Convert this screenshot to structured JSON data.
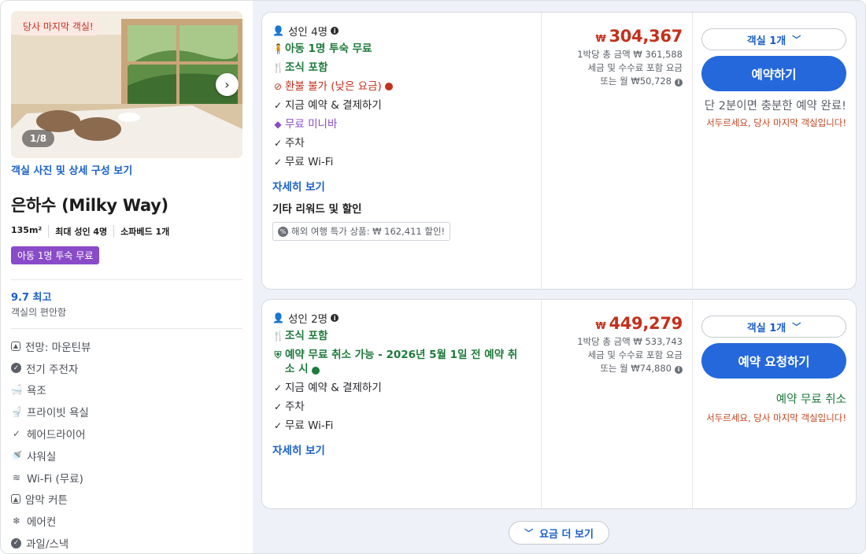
{
  "left": {
    "photo_badge": "당사 마지막 객실!",
    "photo_count": "1/8",
    "photo_link": "객실 사진 및 상세 구성 보기",
    "room_name": "은하수 (Milky Way)",
    "specs": [
      "135m²",
      "최대 성인 4명",
      "소파베드 1개"
    ],
    "promo_badge": "아동 1명 투숙 무료",
    "rating": "9.7 최고",
    "rating_sub": "객실의 편안함",
    "amenities": [
      {
        "label": "전망: 마운틴뷰",
        "icon": "view-icon"
      },
      {
        "label": "전기 주전자",
        "icon": "kettle-icon"
      },
      {
        "label": "욕조",
        "icon": "bathtub-icon"
      },
      {
        "label": "프라이빗 욕실",
        "icon": "toilet-icon"
      },
      {
        "label": "헤어드라이어",
        "icon": "check-icon"
      },
      {
        "label": "샤워실",
        "icon": "shower-icon"
      },
      {
        "label": "Wi-Fi (무료)",
        "icon": "wifi-icon"
      },
      {
        "label": "암막 커튼",
        "icon": "curtain-icon"
      },
      {
        "label": "에어컨",
        "icon": "snowflake-icon"
      },
      {
        "label": "과일/스낵",
        "icon": "snack-icon"
      }
    ]
  },
  "rates": [
    {
      "guests": "성인 4명",
      "features": [
        {
          "text": "아동 1명 투숙 무료",
          "style": "green",
          "icon": "child-icon"
        },
        {
          "text": "조식 포함",
          "style": "green",
          "icon": "cutlery-icon"
        },
        {
          "text": "환불 불가 (낮은 요금)",
          "style": "red",
          "icon": "no-refund-icon"
        },
        {
          "text": "지금 예약 & 결제하기",
          "style": "dark",
          "icon": "check-icon"
        },
        {
          "text": "무료 미니바",
          "style": "purple",
          "icon": "diamond-icon"
        },
        {
          "text": "주차",
          "style": "dark",
          "icon": "check-icon"
        },
        {
          "text": "무료 Wi-Fi",
          "style": "dark",
          "icon": "check-icon"
        }
      ],
      "detail_link": "자세히 보기",
      "other_title": "기타 리워드 및 할인",
      "deal": "해외 여행 특가 상품: ₩ 162,411 할인!",
      "currency": "₩",
      "price": "304,367",
      "price_lines": [
        "1박당 총 금액 ₩ 361,588",
        "세금 및 수수료 포함 요금"
      ],
      "monthly": "또는 월 ₩50,728",
      "rooms_select": "객실 1개",
      "book_label": "예약하기",
      "urgent": "단 2분이면 충분한 예약 완료!",
      "hurry": "서두르세요, 당사 마지막 객실입니다!"
    },
    {
      "guests": "성인 2명",
      "features": [
        {
          "text": "조식 포함",
          "style": "green",
          "icon": "cutlery-icon"
        },
        {
          "text": "예약 무료 취소 가능 - 2026년 5월 1일 전 예약 취소 시",
          "style": "green",
          "icon": "shield-icon"
        },
        {
          "text": "지금 예약 & 결제하기",
          "style": "dark",
          "icon": "check-icon"
        },
        {
          "text": "주차",
          "style": "dark",
          "icon": "check-icon"
        },
        {
          "text": "무료 Wi-Fi",
          "style": "dark",
          "icon": "check-icon"
        }
      ],
      "detail_link": "자세히 보기",
      "currency": "₩",
      "price": "449,279",
      "price_lines": [
        "1박당 총 금액 ₩ 533,743",
        "세금 및 수수료 포함 요금"
      ],
      "monthly": "또는 월 ₩74,880",
      "rooms_select": "객실 1개",
      "book_label": "예약 요청하기",
      "urgent": "예약 무료 취소",
      "hurry": "서두르세요, 당사 마지막 객실입니다!"
    }
  ],
  "more_button": "요금 더 보기",
  "colors": {
    "accent": "#2468dc",
    "price": "#c4301c",
    "green": "#1e7a3a",
    "purple": "#8a4bc8"
  }
}
